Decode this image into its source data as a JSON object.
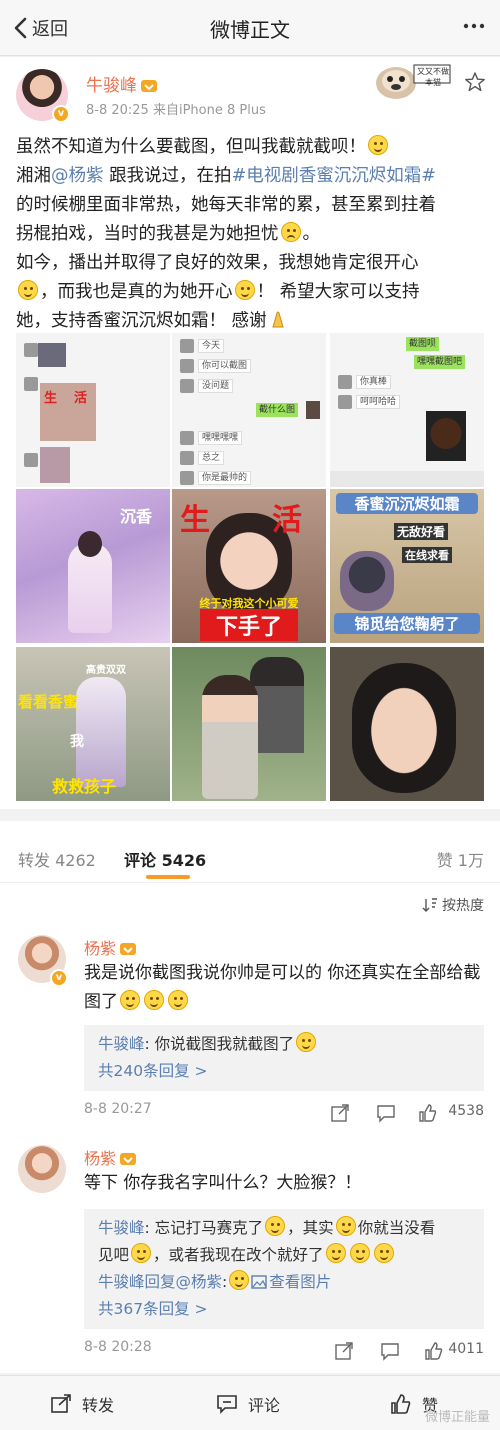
{
  "header": {
    "back_label": "返回",
    "title": "微博正文"
  },
  "post": {
    "author": "牛骏峰",
    "meta": "8-8 20:25  来自iPhone 8 Plus",
    "sticker_text": "又又不做本猫",
    "text": {
      "l1": "虽然不知道为什么要截图，但叫我截就截呗！",
      "l2a": "湘湘",
      "l2b": "@杨紫",
      "l2c": " 跟我说过，在拍",
      "l2d": "#电视剧香蜜沉沉烬如霜#",
      "l3": "的时候棚里面非常热，她每天非常的累，甚至累到拄着",
      "l4a": "拐棍拍戏，当时的我甚是为她担忧",
      "l4b": "。",
      "l5": "如今，播出并取得了良好的效果，我想她肯定很开心",
      "l6a": "，而我也是真的为她开心",
      "l6b": "！ 希望大家可以支持",
      "l7": "她，支持香蜜沉沉烬如霜！ 感谢"
    },
    "images": {
      "img1": {
        "t1": "生",
        "t2": "活"
      },
      "img2": {
        "m1": "今天",
        "m2": "你可以截图",
        "m3": "没问题",
        "m4": "截什么图",
        "m5": "嘿嘿嘿嘿",
        "m6": "总之",
        "m7": "你是最帅的"
      },
      "img3": {
        "m1": "截图呗",
        "m2": "嘿嘿截图吧",
        "m3": "你真棒",
        "m4": "呵呵哈哈"
      },
      "img4": {
        "t1": "沉香"
      },
      "img5": {
        "t1": "生",
        "t2": "活",
        "t3": "终于对我这个小可爱",
        "t4": "下手了"
      },
      "img6": {
        "t1": "香蜜沉沉烬如霜",
        "t2": "无敌好看",
        "t3": "在线求看",
        "t4": "锦觅给您鞠躬了"
      },
      "img7": {
        "t1": "高贵双双",
        "t2": "看看香蜜",
        "t3": "我",
        "t4": "救救孩子"
      }
    }
  },
  "stats": {
    "reposts": "转发 4262",
    "comments": "评论 5426",
    "likes": "赞 1万"
  },
  "comments": {
    "sort_label": "按热度",
    "c1": {
      "author": "杨紫",
      "text": "我是说你截图我说你帅是可以的 你还真实在全部给截图了",
      "reply_name": "牛骏峰",
      "reply_text": ": 你说截图我就截图了",
      "reply_more": "共240条回复 >",
      "time": "8-8 20:27",
      "likes": "4538"
    },
    "c2": {
      "author": "杨紫",
      "text": "等下 你存我名字叫什么？大脸猴？！",
      "reply1_name": "牛骏峰",
      "reply1_a": ": 忘记打马赛克了",
      "reply1_b": "，其实",
      "reply1_c": "你就当没看",
      "reply1_d": "见吧",
      "reply1_e": "，或者我现在改个就好了",
      "reply2_name": "牛骏峰回复@杨紫",
      "reply2_text": ":",
      "reply2_link": "查看图片",
      "reply_more": "共367条回复 >",
      "time": "8-8 20:28",
      "likes": "4011"
    }
  },
  "bottombar": {
    "repost": "转发",
    "comment": "评论",
    "like": "赞"
  },
  "watermark": "微博正能量"
}
